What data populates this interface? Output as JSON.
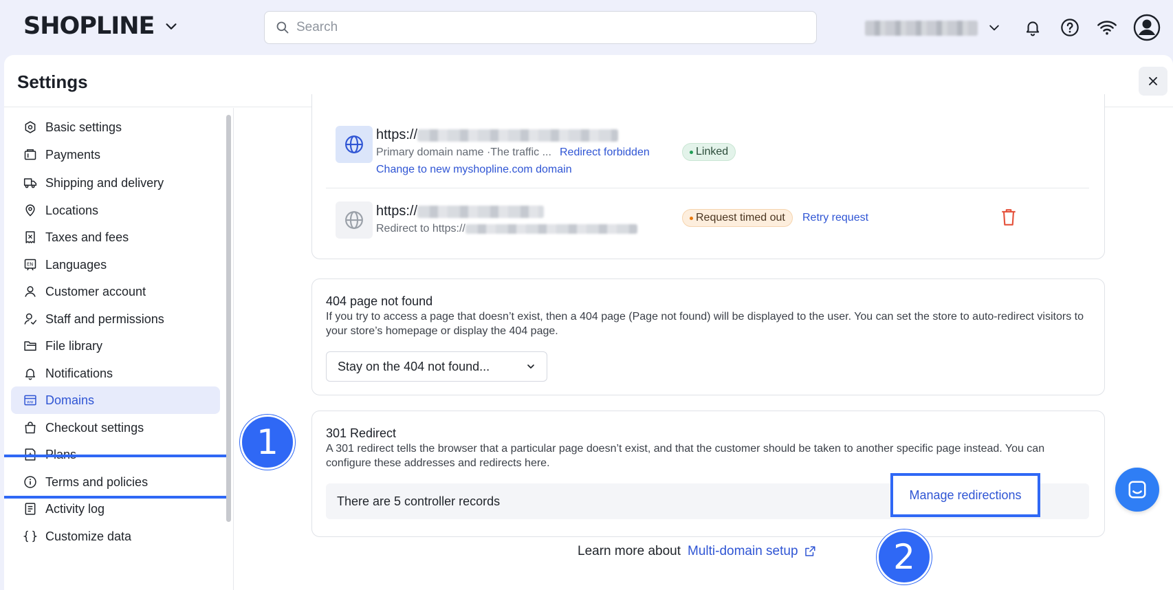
{
  "topbar": {
    "brand": "SHOPLINE",
    "search_placeholder": "Search"
  },
  "settings": {
    "title": "Settings"
  },
  "sidebar": {
    "items": [
      {
        "label": "Basic settings",
        "icon": "gear-icon"
      },
      {
        "label": "Payments",
        "icon": "wallet-icon"
      },
      {
        "label": "Shipping and delivery",
        "icon": "truck-icon"
      },
      {
        "label": "Locations",
        "icon": "location-pin-icon"
      },
      {
        "label": "Taxes and fees",
        "icon": "receipt-icon"
      },
      {
        "label": "Languages",
        "icon": "language-icon"
      },
      {
        "label": "Customer account",
        "icon": "user-icon"
      },
      {
        "label": "Staff and permissions",
        "icon": "staff-icon"
      },
      {
        "label": "File library",
        "icon": "folder-icon"
      },
      {
        "label": "Notifications",
        "icon": "bell-icon"
      },
      {
        "label": "Domains",
        "icon": "domain-icon"
      },
      {
        "label": "Checkout settings",
        "icon": "bag-icon"
      },
      {
        "label": "Plans",
        "icon": "plans-icon"
      },
      {
        "label": "Terms and policies",
        "icon": "info-icon"
      },
      {
        "label": "Activity log",
        "icon": "log-icon"
      },
      {
        "label": "Customize data",
        "icon": "braces-icon"
      }
    ],
    "active_index": 10
  },
  "domains": {
    "primary": {
      "url_prefix": "https://",
      "subtitle": "Primary domain name ·The traffic ...",
      "redirect_link": "Redirect forbidden",
      "change_link": "Change to new myshopline.com domain",
      "status": "Linked"
    },
    "secondary": {
      "url_prefix": "https://",
      "subtitle": "Redirect to https://",
      "status": "Request timed out",
      "retry_link": "Retry request"
    }
  },
  "not_found": {
    "title": "404 page not found",
    "description": "If you try to access a page that doesn’t exist, then a 404 page (Page not found) will be displayed to the user. You can set the store to auto-redirect visitors to your store’s homepage or display the 404 page.",
    "select_value": "Stay on the 404 not found..."
  },
  "redirect": {
    "title": "301 Redirect",
    "description": "A 301 redirect tells the browser that a particular page doesn’t exist, and that the customer should be taken to another specific page instead. You can configure these addresses and redirects here.",
    "records": "There are 5 controller records",
    "manage_button": "Manage redirections"
  },
  "footer": {
    "learn_text": "Learn more about",
    "learn_link": "Multi-domain setup"
  },
  "steps": {
    "one": "1",
    "two": "2"
  },
  "colors": {
    "accent": "#2f55d4",
    "highlight": "#2f68f5",
    "linked": "#1f9d55",
    "timeout": "#e8790d",
    "delete": "#e5533d"
  }
}
